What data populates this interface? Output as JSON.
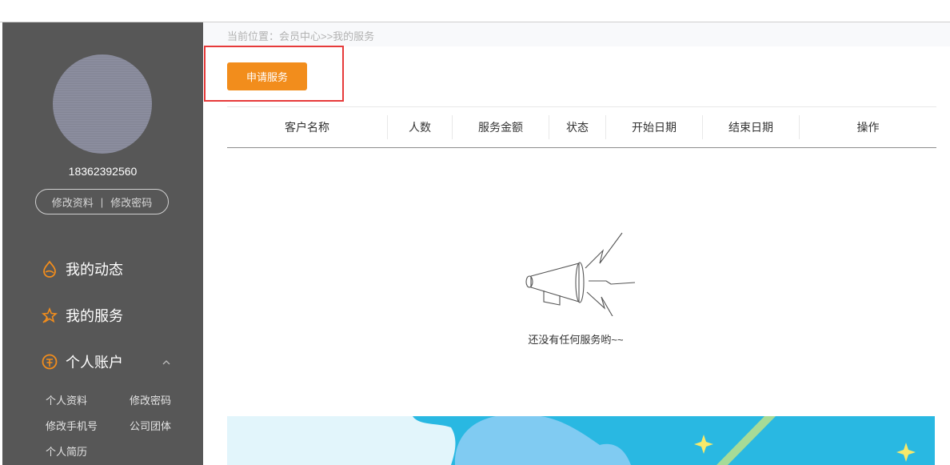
{
  "breadcrumb": "当前位置：会员中心>>我的服务",
  "profile": {
    "phone": "18362392560",
    "edit_profile": "修改资料",
    "separator": "|",
    "change_password": "修改密码"
  },
  "nav": {
    "dynamics": "我的动态",
    "services": "我的服务",
    "account": "个人账户",
    "account_items": [
      "个人资料",
      "修改密码",
      "修改手机号",
      "公司团体",
      "个人简历"
    ]
  },
  "actions": {
    "apply": "申请服务"
  },
  "table": {
    "columns": [
      "客户名称",
      "人数",
      "服务金额",
      "状态",
      "开始日期",
      "结束日期",
      "操作"
    ]
  },
  "empty": {
    "message": "还没有任何服务哟~~"
  },
  "colors": {
    "sidebar": "#575757",
    "accent": "#f28d1c",
    "highlight": "#e63a3a",
    "banner": "#29b8e2"
  },
  "icons": {
    "dynamics": "drop-icon",
    "services": "star-icon",
    "account": "coin-icon",
    "collapse": "chevron-up-icon",
    "empty": "megaphone-icon"
  }
}
